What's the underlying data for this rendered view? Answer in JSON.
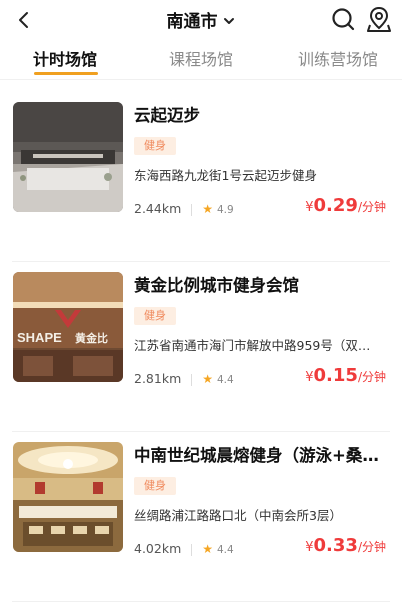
{
  "header": {
    "city": "南通市",
    "colors": {
      "accent": "#f0a020",
      "price": "#ef3b3b",
      "tag_bg": "#fdeee2",
      "tag_text": "#f08a5d"
    },
    "icons": [
      "back-arrow-icon",
      "chevron-down-icon",
      "search-icon",
      "location-pin-icon"
    ]
  },
  "tabs": [
    {
      "label": "计时场馆",
      "active": true
    },
    {
      "label": "课程场馆",
      "active": false
    },
    {
      "label": "训练营场馆",
      "active": false
    }
  ],
  "venues": [
    {
      "name": "云起迈步",
      "tag": "健身",
      "address": "东海西路九龙街1号云起迈步健身",
      "distance": "2.44km",
      "rating": "4.9",
      "currency": "¥",
      "price": "0.29",
      "unit": "/分钟"
    },
    {
      "name": "黄金比例城市健身会馆",
      "tag": "健身",
      "address": "江苏省南通市海门市解放中路959号（双…",
      "distance": "2.81km",
      "rating": "4.4",
      "currency": "¥",
      "price": "0.15",
      "unit": "/分钟"
    },
    {
      "name": "中南世纪城晨熔健身（游泳+桑…",
      "tag": "健身",
      "address": "丝绸路浦江路路口北（中南会所3层）",
      "distance": "4.02km",
      "rating": "4.4",
      "currency": "¥",
      "price": "0.33",
      "unit": "/分钟"
    }
  ]
}
